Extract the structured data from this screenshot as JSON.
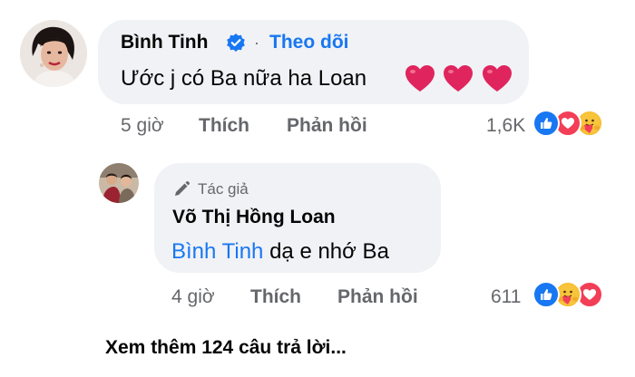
{
  "comment": {
    "author": "Bình Tinh",
    "separator": "·",
    "follow_label": "Theo dõi",
    "text": "Ước j có Ba nữa ha Loan",
    "time": "5 giờ",
    "like_label": "Thích",
    "reply_label": "Phản hồi",
    "reaction_count": "1,6K",
    "reactions": [
      "like-icon",
      "love-icon",
      "care-icon"
    ]
  },
  "reply": {
    "badge_label": "Tác giả",
    "author": "Võ Thị Hồng Loan",
    "mention": "Bình Tinh",
    "text": " dạ e nhớ Ba",
    "time": "4 giờ",
    "like_label": "Thích",
    "reply_label": "Phản hồi",
    "reaction_count": "611",
    "reactions": [
      "like-icon",
      "care-icon",
      "love-icon"
    ]
  },
  "more_replies_label": "Xem thêm 124 câu trả lời...",
  "colors": {
    "link_blue": "#1877f2",
    "bubble_gray": "#f0f2f5",
    "meta_gray": "#65676b",
    "heart_red": "#e0245e"
  }
}
